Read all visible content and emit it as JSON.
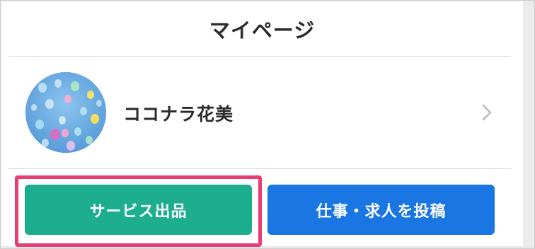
{
  "header": {
    "title": "マイページ"
  },
  "profile": {
    "name": "ココナラ花美",
    "avatar_icon": "balloons-avatar",
    "chevron_icon": "chevron-right-icon"
  },
  "actions": {
    "service_label": "サービス出品",
    "post_label": "仕事・求人を投稿"
  },
  "colors": {
    "service_button": "#1dae8f",
    "post_button": "#1a76e3",
    "highlight_border": "#ea3d73",
    "text": "#2b2b2b"
  }
}
